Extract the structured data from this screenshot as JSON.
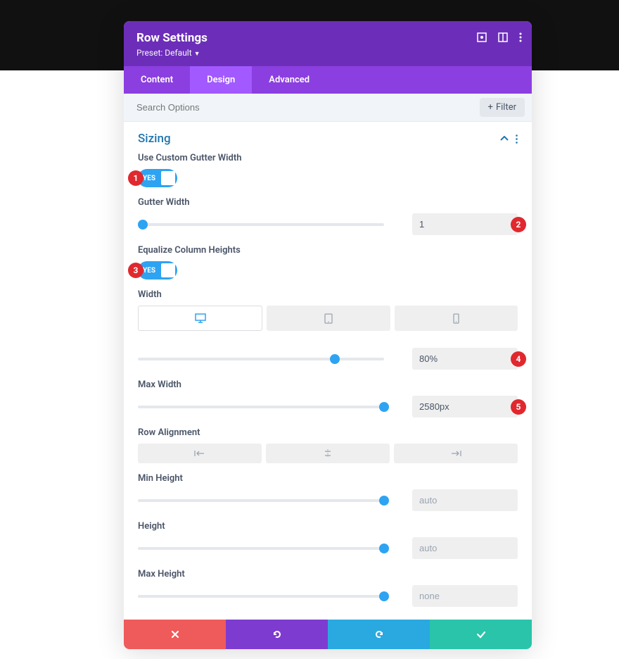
{
  "header": {
    "title": "Row Settings",
    "preset_label": "Preset: Default"
  },
  "tabs": {
    "content": "Content",
    "design": "Design",
    "advanced": "Advanced"
  },
  "search": {
    "placeholder": "Search Options",
    "filter": "Filter"
  },
  "section": {
    "title": "Sizing",
    "custom_gutter_label": "Use Custom Gutter Width",
    "gutter_width_label": "Gutter Width",
    "gutter_width_value": "1",
    "equalize_label": "Equalize Column Heights",
    "width_label": "Width",
    "width_value": "80%",
    "max_width_label": "Max Width",
    "max_width_value": "2580px",
    "row_alignment_label": "Row Alignment",
    "min_height_label": "Min Height",
    "min_height_placeholder": "auto",
    "height_label": "Height",
    "height_placeholder": "auto",
    "max_height_label": "Max Height",
    "max_height_placeholder": "none",
    "toggle_yes": "YES"
  },
  "markers": {
    "m1": "1",
    "m2": "2",
    "m3": "3",
    "m4": "4",
    "m5": "5"
  }
}
